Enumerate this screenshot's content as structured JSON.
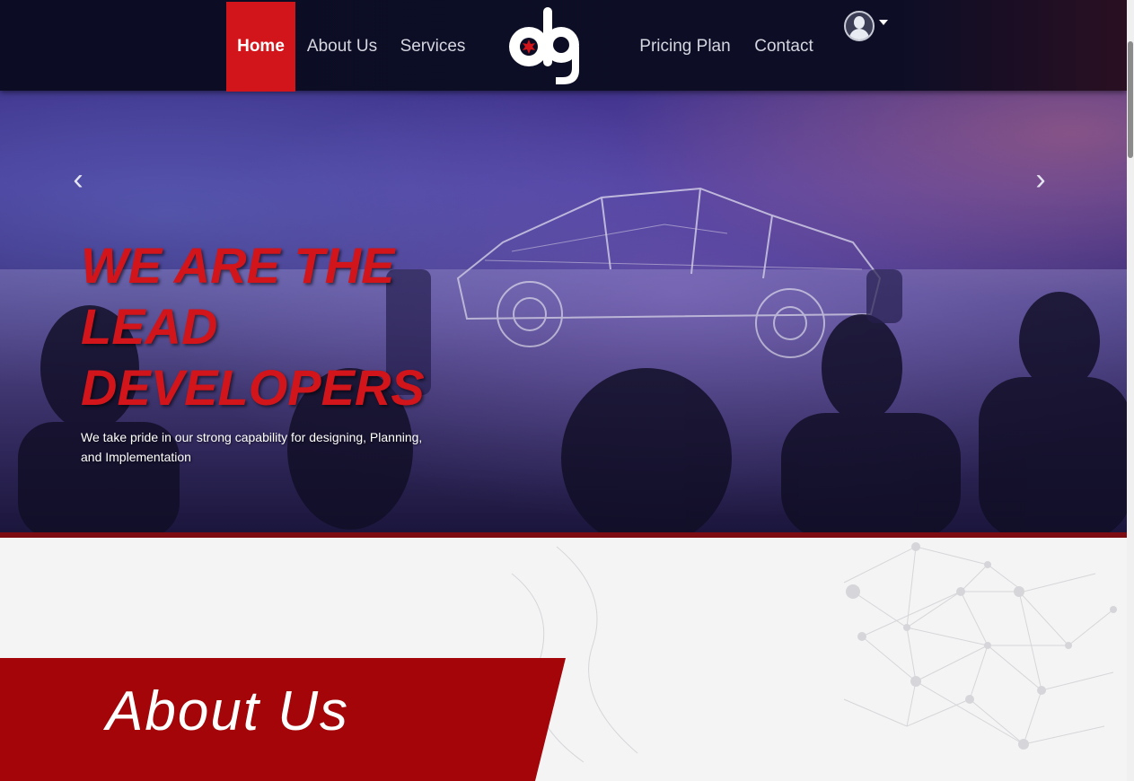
{
  "nav": {
    "items": [
      {
        "label": "Home",
        "active": true
      },
      {
        "label": "About Us",
        "active": false
      },
      {
        "label": "Services",
        "active": false
      },
      {
        "label": "Pricing Plan",
        "active": false
      },
      {
        "label": "Contact",
        "active": false
      }
    ],
    "logo_text": "obg",
    "user_icon": "user-avatar-icon",
    "dropdown_icon": "caret-down-icon"
  },
  "hero": {
    "headline": "WE ARE THE LEAD DEVELOPERS",
    "subtext": "We take pride in our strong capability for designing, Planning, and Implementation",
    "prev_icon": "chevron-left-icon",
    "next_icon": "chevron-right-icon",
    "prev_glyph": "‹",
    "next_glyph": "›"
  },
  "about": {
    "title": "About Us"
  },
  "colors": {
    "brand_red": "#d2151b",
    "banner_red": "#a30509",
    "navbar_bg": "#0c0d24",
    "divider_red": "#7d0c12"
  }
}
